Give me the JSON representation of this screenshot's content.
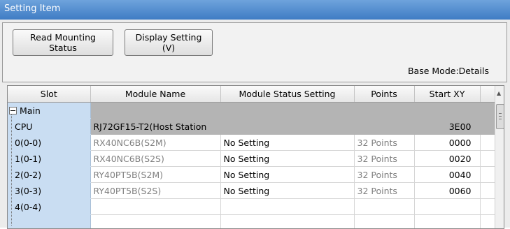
{
  "window": {
    "title": "Setting Item"
  },
  "toolbar": {
    "read_mounting_line1": "Read Mounting",
    "read_mounting_line2": "Status",
    "display_setting_line1": "Display Setting",
    "display_setting_line2": "(V)",
    "base_mode": "Base Mode:Details"
  },
  "table": {
    "columns": [
      "Slot",
      "Module Name",
      "Module Status Setting",
      "Points",
      "Start XY"
    ],
    "main_label": "Main",
    "rows": [
      {
        "slot": "CPU",
        "module": "RJ72GF15-T2(Host Station",
        "status": "",
        "points": "",
        "start": "3E00"
      },
      {
        "slot": "0(0-0)",
        "module": "RX40NC6B(S2M)",
        "status": "No Setting",
        "points": "32 Points",
        "start": "0000"
      },
      {
        "slot": "1(0-1)",
        "module": "RX40NC6B(S2S)",
        "status": "No Setting",
        "points": "32 Points",
        "start": "0020"
      },
      {
        "slot": "2(0-2)",
        "module": "RY40PT5B(S2M)",
        "status": "No Setting",
        "points": "32 Points",
        "start": "0040"
      },
      {
        "slot": "3(0-3)",
        "module": "RY40PT5B(S2S)",
        "status": "No Setting",
        "points": "32 Points",
        "start": "0060"
      },
      {
        "slot": "4(0-4)",
        "module": "",
        "status": "",
        "points": "",
        "start": ""
      }
    ]
  },
  "colors": {
    "title_bar": "#4a86cc",
    "slot_column": "#c9ddf2",
    "highlight_row": "#b4b4b4"
  }
}
